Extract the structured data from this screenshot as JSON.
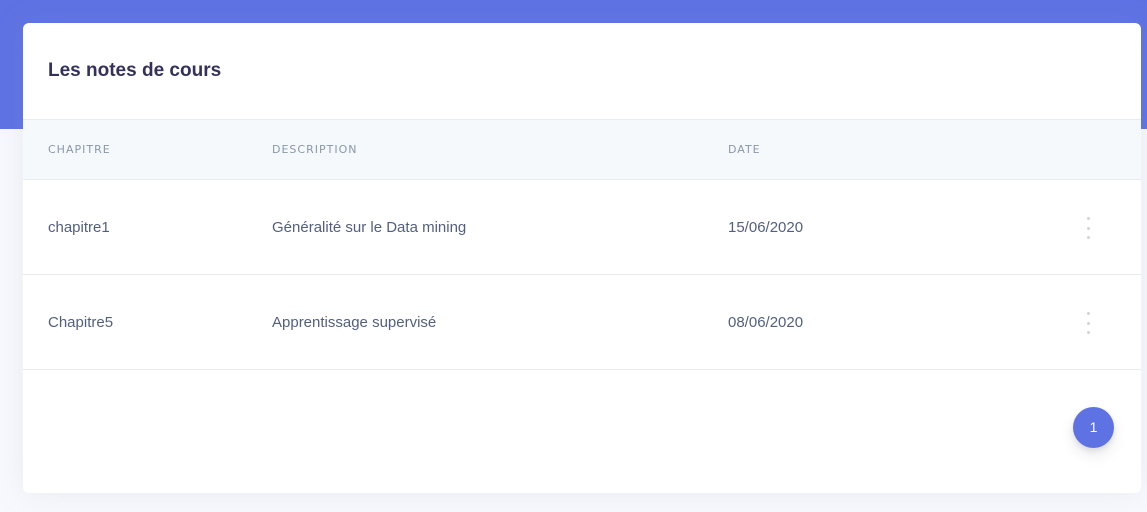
{
  "card": {
    "title": "Les notes de cours"
  },
  "table": {
    "headers": {
      "chapitre": "CHAPITRE",
      "description": "DESCRIPTION",
      "date": "DATE"
    },
    "rows": [
      {
        "chapitre": "chapitre1",
        "description": "Généralité sur le Data mining",
        "date": "15/06/2020",
        "menu_icon": "vertical-ellipsis-icon"
      },
      {
        "chapitre": "Chapitre5",
        "description": "Apprentissage supervisé",
        "date": "08/06/2020",
        "menu_icon": "vertical-ellipsis-icon"
      }
    ]
  },
  "pagination": {
    "current_page": "1"
  },
  "colors": {
    "accent": "#5e72e4",
    "background": "#f8f9fe",
    "card": "#ffffff",
    "header_row": "#f6f9fc"
  }
}
